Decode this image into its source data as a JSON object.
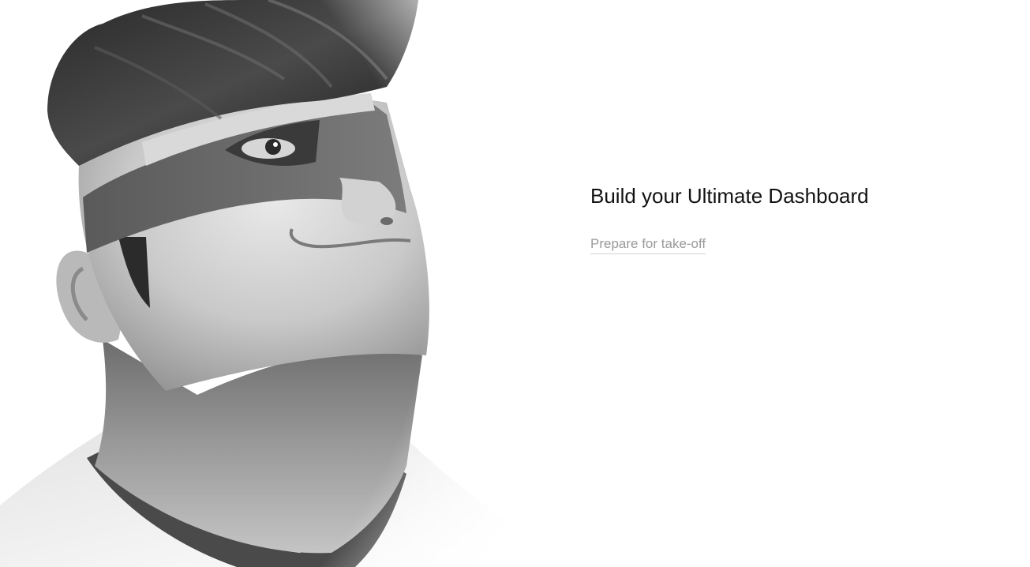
{
  "hero": {
    "headline": "Build your Ultimate Dashboard",
    "cta_label": "Prepare for take-off"
  },
  "illustration": {
    "subject": "masked-hero-character"
  },
  "colors": {
    "background": "#ffffff",
    "headline": "#111111",
    "link": "#9a9a9a",
    "link_underline": "#d4d4d4"
  }
}
